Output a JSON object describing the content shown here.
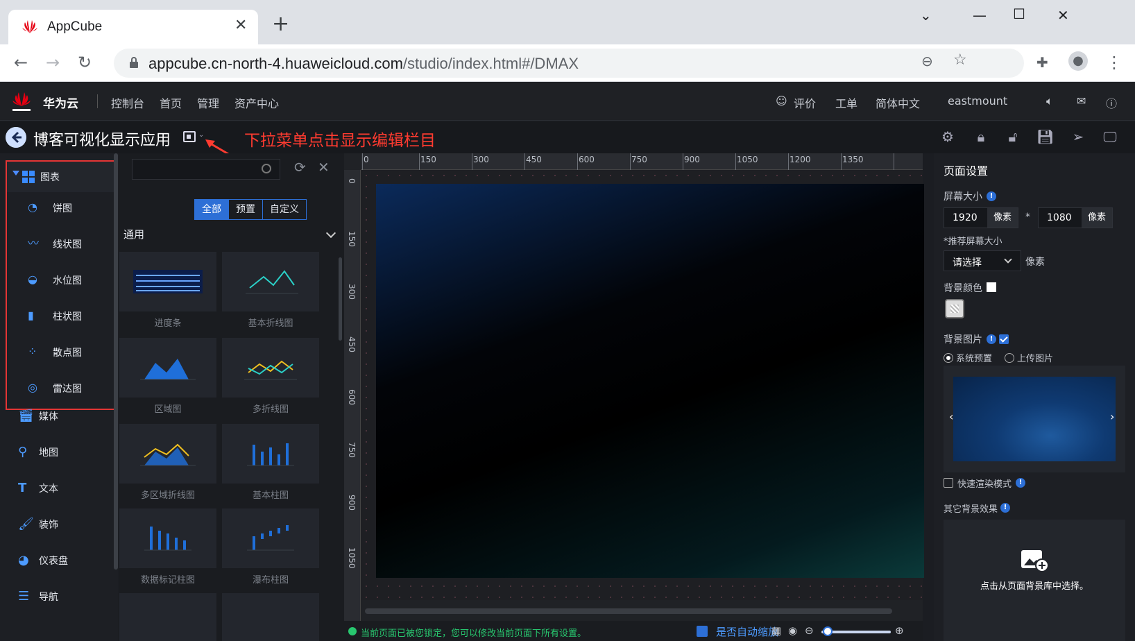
{
  "browser": {
    "tab_title": "AppCube",
    "url_host": "appcube.cn-north-4.huaweicloud.com",
    "url_path": "/studio/index.html#/DMAX"
  },
  "header": {
    "brand": "华为云",
    "nav": [
      "控制台",
      "首页",
      "管理",
      "资产中心"
    ],
    "rate": "评价",
    "ticket": "工单",
    "language": "简体中文",
    "user": "eastmount"
  },
  "studio": {
    "title": "博客可视化显示应用",
    "annotation": "下拉菜单点击显示编辑栏目"
  },
  "leftnav": {
    "group_label": "图表",
    "chart_items": [
      "饼图",
      "线状图",
      "水位图",
      "柱状图",
      "散点图",
      "雷达图"
    ],
    "other_items": [
      "媒体",
      "地图",
      "文本",
      "装饰",
      "仪表盘",
      "导航"
    ]
  },
  "library": {
    "search_placeholder": "",
    "tabs": [
      "全部",
      "预置",
      "自定义"
    ],
    "active_tab": "全部",
    "category": "通用",
    "components": [
      "进度条",
      "基本折线图",
      "区域图",
      "多折线图",
      "多区域折线图",
      "基本柱图",
      "数据标记柱图",
      "瀑布柱图"
    ]
  },
  "canvas": {
    "ruler_h": [
      "150",
      "300",
      "450",
      "600",
      "750",
      "900",
      "1050",
      "1200",
      "1350"
    ],
    "ruler_h_zero": "0",
    "ruler_v": [
      "0",
      "150",
      "300",
      "450",
      "600",
      "750",
      "900",
      "1050"
    ],
    "status_text": "当前页面已被您锁定，您可以修改当前页面下所有设置。",
    "autozoom_label": "是否自动缩放"
  },
  "panel": {
    "title": "页面设置",
    "screen_size_label": "屏幕大小",
    "width": "1920",
    "height": "1080",
    "unit": "像素",
    "times": "*",
    "recommend_label": "*推荐屏幕大小",
    "select_value": "请选择",
    "select_unit": "像素",
    "bg_color_label": "背景颜色",
    "bg_image_label": "背景图片",
    "radio_system": "系统预置",
    "radio_upload": "上传图片",
    "fast_render_label": "快速渲染模式",
    "other_effect_label": "其它背景效果",
    "upload_text": "点击从页面背景库中选择。"
  },
  "colors": {
    "accent": "#2d6fd6",
    "annotation": "#ff3b30",
    "status": "#28c76f"
  }
}
